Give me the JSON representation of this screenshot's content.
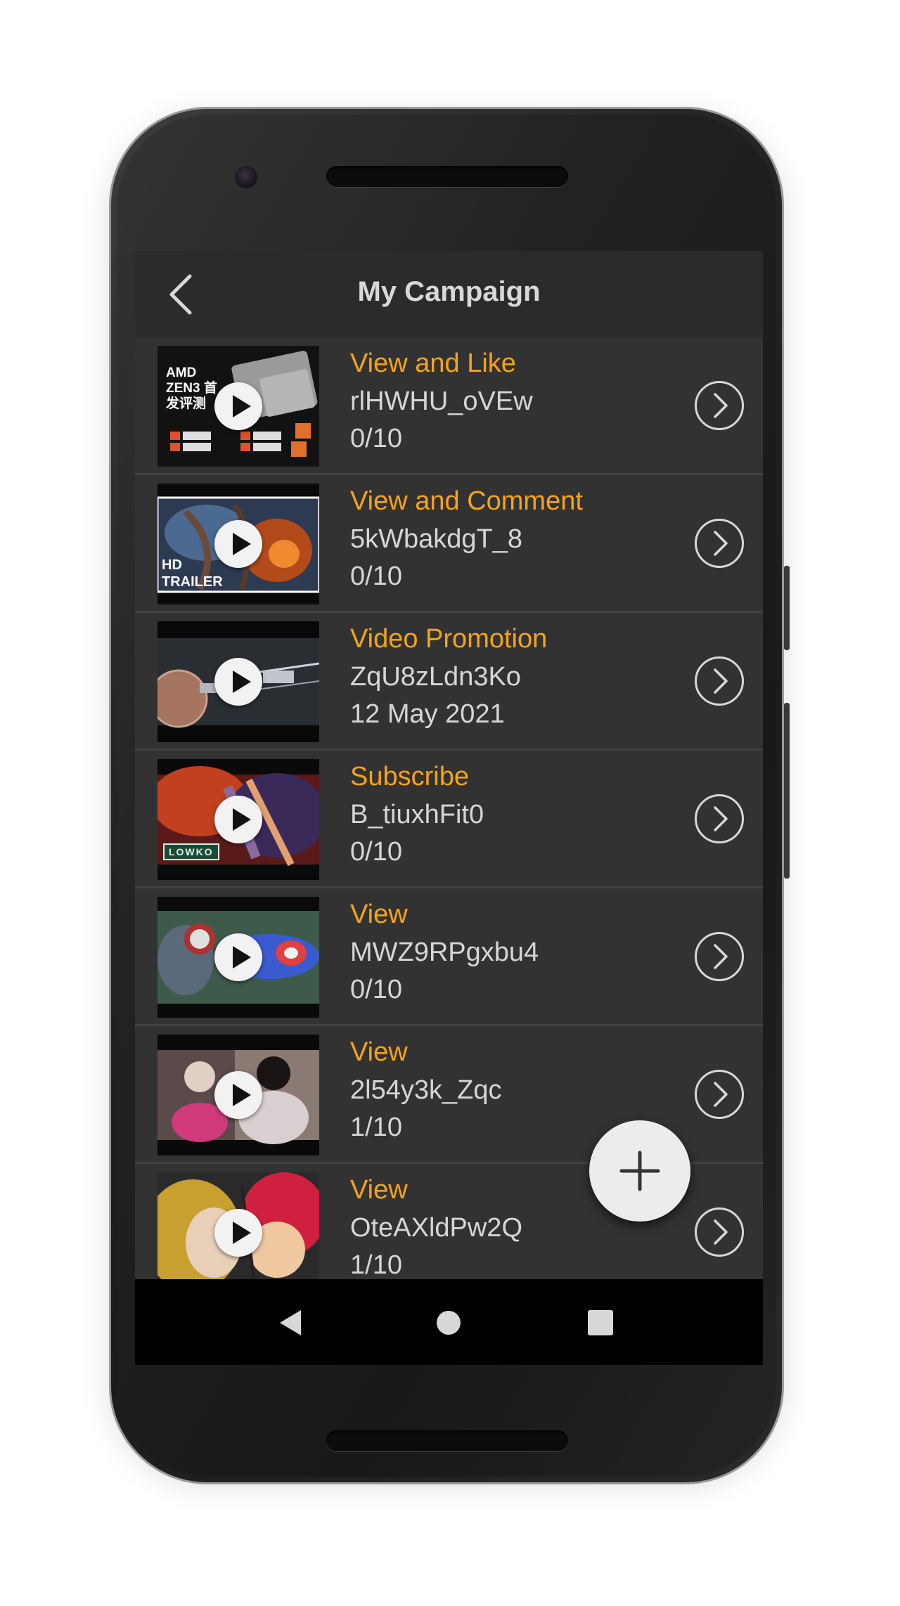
{
  "app": {
    "title": "My Campaign",
    "accent_color": "#f5a31a",
    "back_icon": "chevron-left-icon",
    "fab_icon": "plus-icon"
  },
  "campaigns": [
    {
      "type": "View and Like",
      "video_id": "rlHWHU_oVEw",
      "progress": "0/10",
      "thumb_text": "AMD ZEN3 首发评测"
    },
    {
      "type": "View and Comment",
      "video_id": "5kWbakdgT_8",
      "progress": "0/10",
      "thumb_text": "HD TRAILER"
    },
    {
      "type": "Video Promotion",
      "video_id": "ZqU8zLdn3Ko",
      "progress": "12 May 2021",
      "thumb_text": ""
    },
    {
      "type": "Subscribe",
      "video_id": "B_tiuxhFit0",
      "progress": "0/10",
      "thumb_text": "LOWKO"
    },
    {
      "type": "View",
      "video_id": "MWZ9RPgxbu4",
      "progress": "0/10",
      "thumb_text": ""
    },
    {
      "type": "View",
      "video_id": "2l54y3k_Zqc",
      "progress": "1/10",
      "thumb_text": ""
    },
    {
      "type": "View",
      "video_id": "OteAXldPw2Q",
      "progress": "1/10",
      "thumb_text": ""
    }
  ],
  "navbar": {
    "back_icon": "triangle-back-icon",
    "home_icon": "circle-home-icon",
    "recents_icon": "square-recents-icon"
  }
}
